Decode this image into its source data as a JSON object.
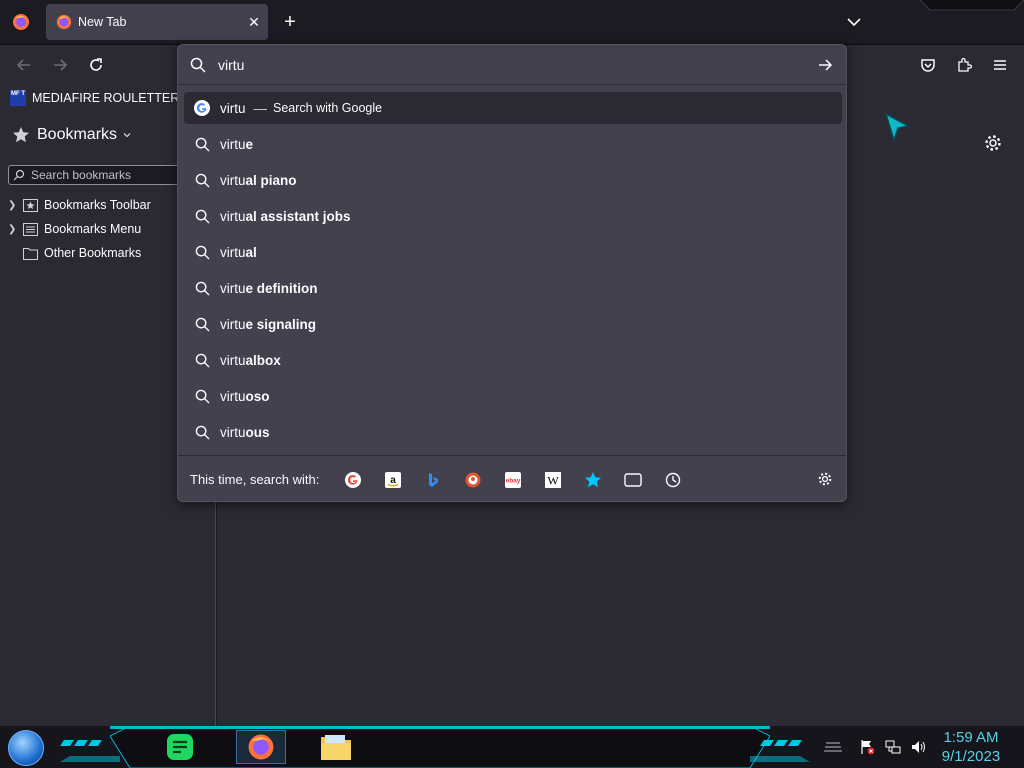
{
  "tab": {
    "title": "New Tab",
    "close": "✕"
  },
  "newtab": "+",
  "bookmarks_toolbar": {
    "item": "MEDIAFIRE ROULETTER",
    "item_icon_text": "MF T"
  },
  "sidebar": {
    "title": "Bookmarks",
    "search_placeholder": "Search bookmarks",
    "items": [
      {
        "label": "Bookmarks Toolbar",
        "icon": "star-folder-icon",
        "expandable": true
      },
      {
        "label": "Bookmarks Menu",
        "icon": "menu-folder-icon",
        "expandable": true
      },
      {
        "label": "Other Bookmarks",
        "icon": "folder-icon",
        "expandable": false
      }
    ]
  },
  "urlbar": {
    "value": "virtu",
    "heuristic": {
      "text": "virtu",
      "separator": "—",
      "action": "Search with Google"
    },
    "suggestions": [
      {
        "typed": "virtu",
        "completion": "e"
      },
      {
        "typed": "virtu",
        "completion": "al piano"
      },
      {
        "typed": "virtu",
        "completion": "al assistant jobs"
      },
      {
        "typed": "virtu",
        "completion": "al"
      },
      {
        "typed": "virtu",
        "completion": "e definition"
      },
      {
        "typed": "virtu",
        "completion": "e signaling"
      },
      {
        "typed": "virtu",
        "completion": "albox"
      },
      {
        "typed": "virtu",
        "completion": "oso"
      },
      {
        "typed": "virtu",
        "completion": "ous"
      }
    ],
    "oneoff_label": "This time, search with:",
    "engines": [
      "google-icon",
      "amazon-icon",
      "bing-icon",
      "duckduckgo-icon",
      "ebay-icon",
      "wikipedia-icon",
      "bookmarks-icon",
      "tabs-icon",
      "history-icon"
    ]
  },
  "taskbar": {
    "clock_time": "1:59 AM",
    "clock_date": "9/1/2023"
  },
  "colors": {
    "accent": "#00c8ff",
    "popup_bg": "#42414d",
    "toolbar_bg": "#2b2a33",
    "clock": "#5bd0e8"
  }
}
